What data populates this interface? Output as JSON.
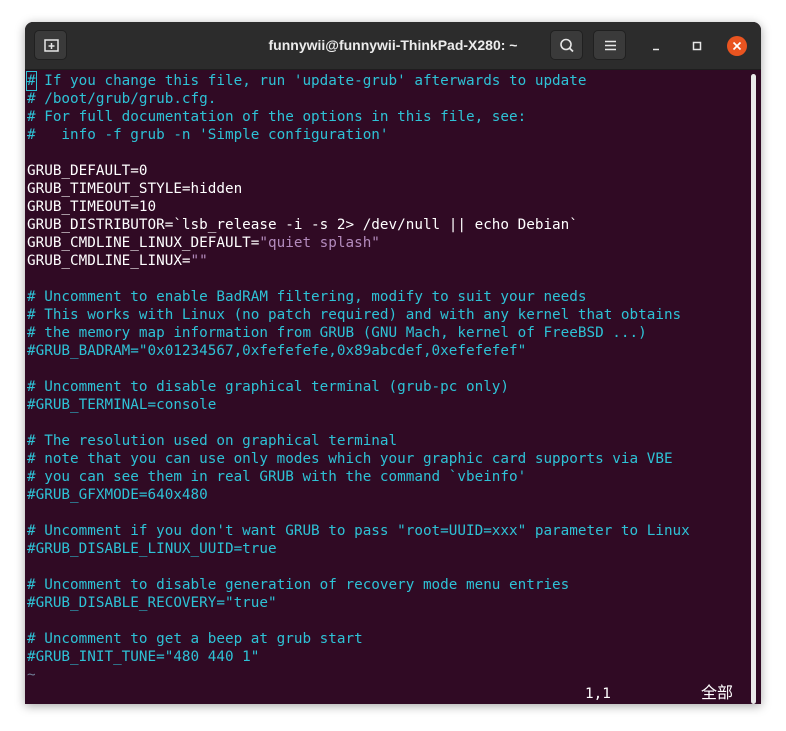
{
  "window": {
    "title": "funnywii@funnywii-ThinkPad-X280: ~"
  },
  "titlebar": {
    "new_tab_icon": "new-tab-icon",
    "search_icon": "search-icon",
    "menu_icon": "hamburger-menu-icon",
    "minimize_icon": "minimize-icon",
    "maximize_icon": "maximize-icon",
    "close_icon": "close-icon",
    "close_color": "#e95420"
  },
  "terminal": {
    "colors": {
      "background": "#300a24",
      "comment": "#2ec2d6",
      "text": "#ffffff",
      "string": "#b38bbd",
      "tilde": "#6e7b93"
    },
    "line1_cursor": "#",
    "line1_rest": " If you change this file, run 'update-grub' afterwards to update",
    "line2": "# /boot/grub/grub.cfg.",
    "line3": "# For full documentation of the options in this file, see:",
    "line4": "#   info -f grub -n 'Simple configuration'",
    "line6": "GRUB_DEFAULT=0",
    "line7": "GRUB_TIMEOUT_STYLE=hidden",
    "line8": "GRUB_TIMEOUT=10",
    "line9": "GRUB_DISTRIBUTOR=`lsb_release -i -s 2> /dev/null || echo Debian`",
    "line10_key": "GRUB_CMDLINE_LINUX_DEFAULT=",
    "line10_val": "\"quiet splash\"",
    "line11_key": "GRUB_CMDLINE_LINUX=",
    "line11_val": "\"\"",
    "line13": "# Uncomment to enable BadRAM filtering, modify to suit your needs",
    "line14": "# This works with Linux (no patch required) and with any kernel that obtains",
    "line15": "# the memory map information from GRUB (GNU Mach, kernel of FreeBSD ...)",
    "line16": "#GRUB_BADRAM=\"0x01234567,0xfefefefe,0x89abcdef,0xefefefef\"",
    "line18": "# Uncomment to disable graphical terminal (grub-pc only)",
    "line19": "#GRUB_TERMINAL=console",
    "line21": "# The resolution used on graphical terminal",
    "line22": "# note that you can use only modes which your graphic card supports via VBE",
    "line23": "# you can see them in real GRUB with the command `vbeinfo'",
    "line24": "#GRUB_GFXMODE=640x480",
    "line26": "# Uncomment if you don't want GRUB to pass \"root=UUID=xxx\" parameter to Linux",
    "line27": "#GRUB_DISABLE_LINUX_UUID=true",
    "line29": "# Uncomment to disable generation of recovery mode menu entries",
    "line30": "#GRUB_DISABLE_RECOVERY=\"true\"",
    "line32": "# Uncomment to get a beep at grub start",
    "line33": "#GRUB_INIT_TUNE=\"480 440 1\"",
    "tilde": "~",
    "status_position": "1,1",
    "status_all": "全部"
  }
}
